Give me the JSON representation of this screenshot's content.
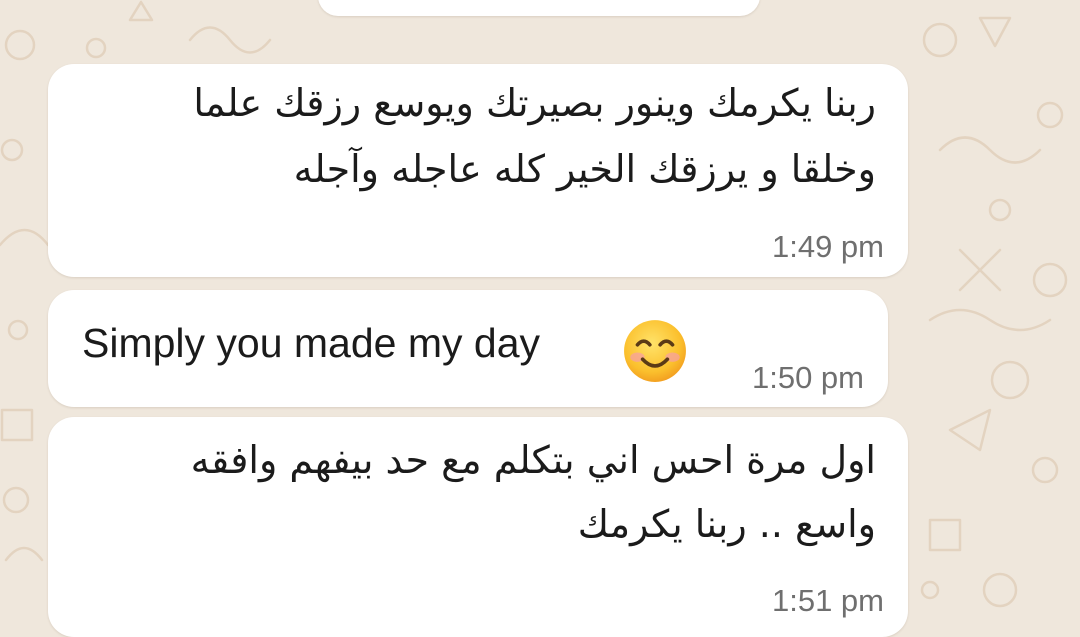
{
  "chat": {
    "messages": [
      {
        "lines": [
          "ربنا يكرمك وينور بصيرتك ويوسع رزقك علما",
          "وخلقا و يرزقك الخير كله عاجله وآجله"
        ],
        "time": "1:49 pm"
      },
      {
        "text": "Simply you made my day",
        "emoji": "smiling-face-emoji",
        "time": "1:50 pm"
      },
      {
        "lines": [
          "اول مرة احس اني بتكلم مع حد بيفهم وافقه",
          "واسع .. ربنا يكرمك"
        ],
        "time": "1:51 pm"
      }
    ]
  },
  "colors": {
    "wallpaper": "#efe7dc",
    "doodle": "#e3d3c0",
    "bubble": "#ffffff",
    "text": "#1b1b1b",
    "timestamp": "#6f6f6f"
  }
}
